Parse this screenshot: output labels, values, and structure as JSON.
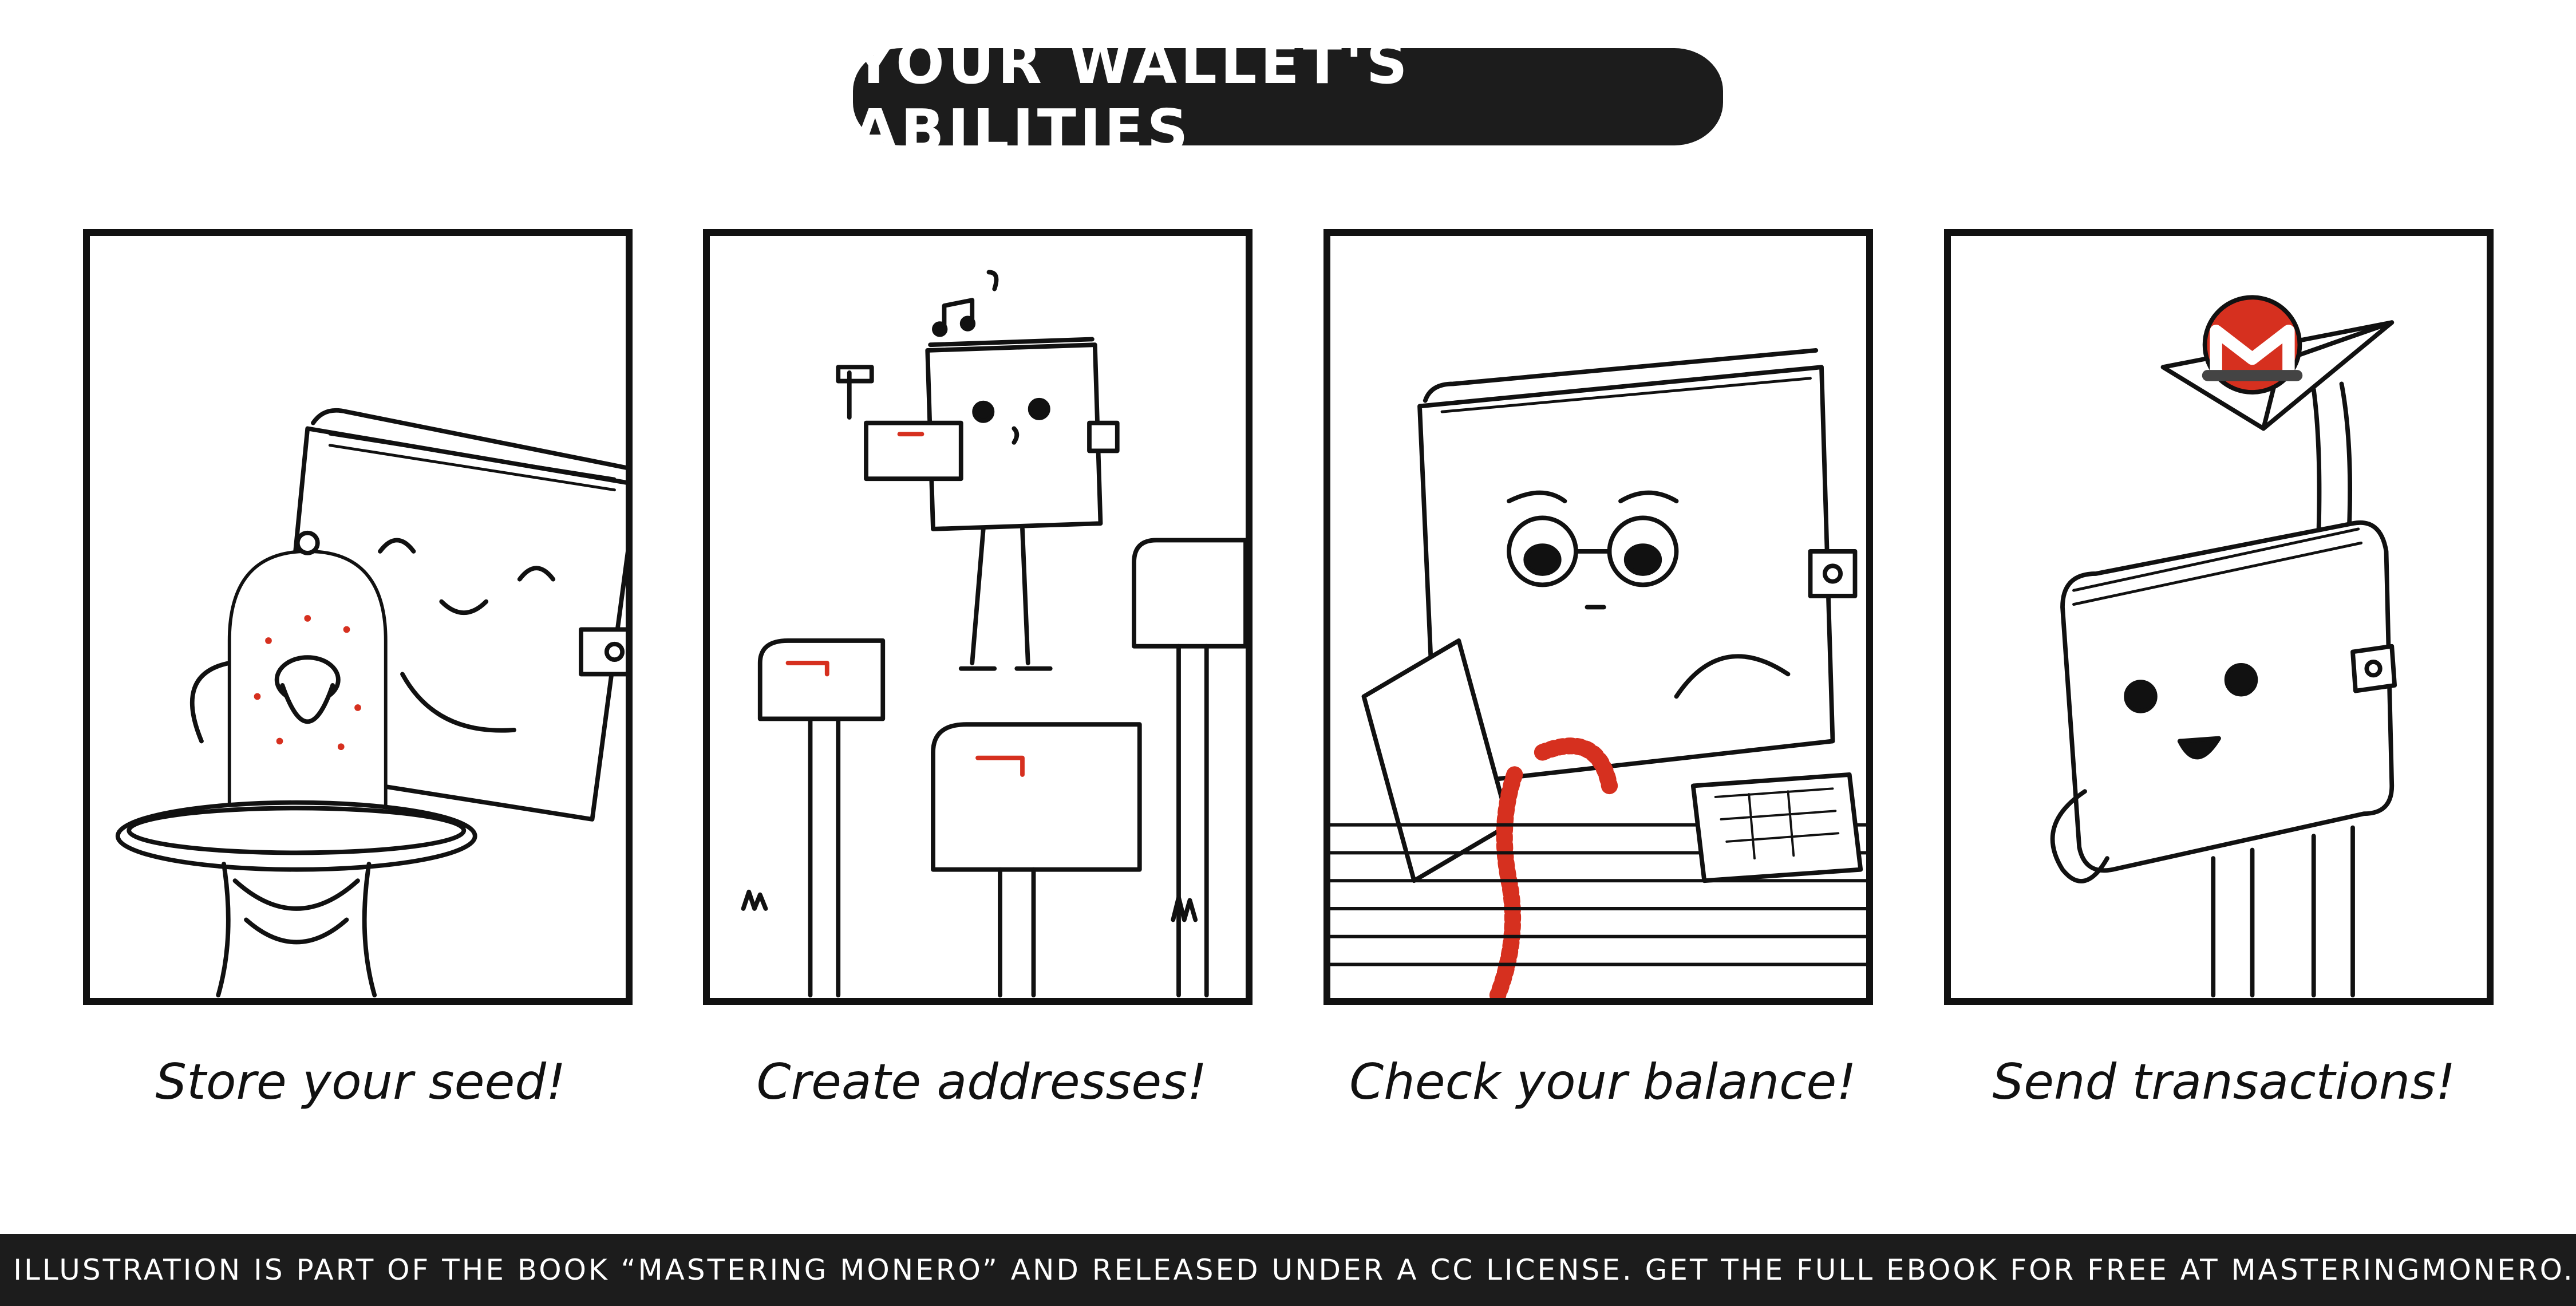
{
  "title": "YOUR WALLET'S ABILITIES",
  "panels": [
    {
      "caption": "Store your seed!",
      "icon": "seed-acorn-icon"
    },
    {
      "caption": "Create addresses!",
      "icon": "mailbox-icon"
    },
    {
      "caption": "Check your balance!",
      "icon": "receipt-icon"
    },
    {
      "caption": "Send transactions!",
      "icon": "paper-plane-icon"
    }
  ],
  "colors": {
    "ink": "#111111",
    "accent": "#d6301f",
    "banner": "#1c1c1c"
  },
  "footer": "THIS ILLUSTRATION IS PART OF THE BOOK “MASTERING MONERO” AND RELEASED UNDER A CC LICENSE. GET THE FULL EBOOK FOR FREE AT MASTERINGMONERO.COM"
}
